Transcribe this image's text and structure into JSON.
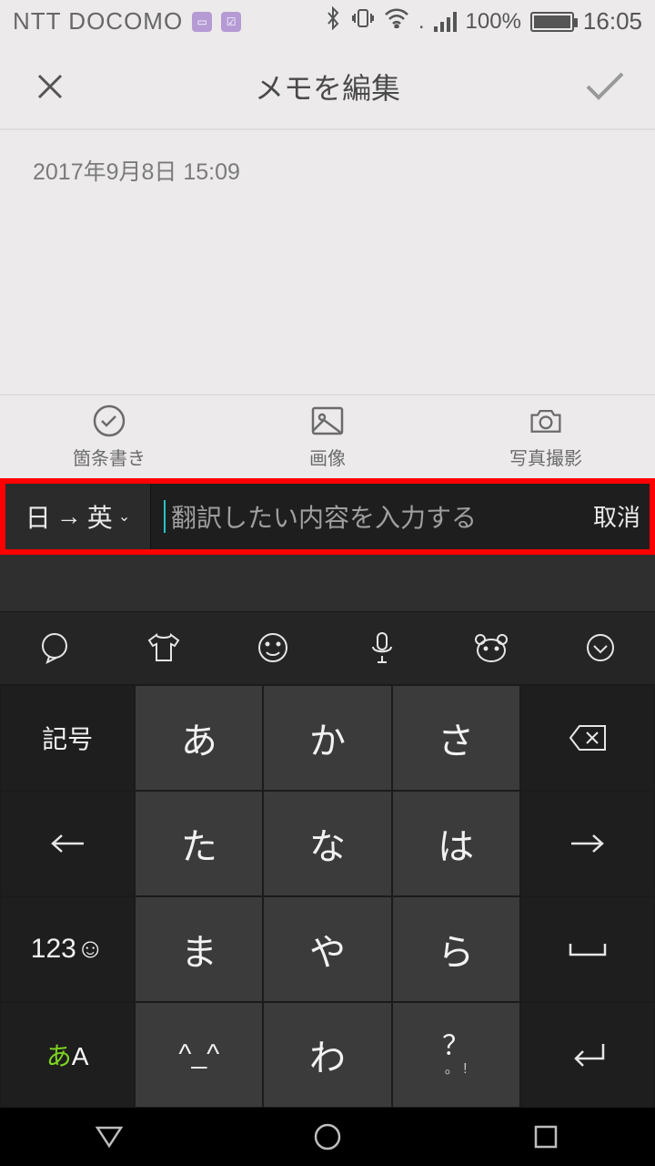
{
  "status": {
    "carrier": "NTT DOCOMO",
    "battery_pct": "100%",
    "clock": "16:05"
  },
  "header": {
    "title": "メモを編集"
  },
  "memo": {
    "timestamp": "2017年9月8日 15:09"
  },
  "toolbar": {
    "bullet": "箇条書き",
    "image": "画像",
    "camera": "写真撮影"
  },
  "translate": {
    "lang_from": "日",
    "lang_to": "英",
    "placeholder": "翻訳したい内容を入力する",
    "cancel": "取消"
  },
  "keys": {
    "sym": "記号",
    "a": "あ",
    "ka": "か",
    "sa": "さ",
    "ta": "た",
    "na": "な",
    "ha": "は",
    "num": "123☺",
    "ma": "ま",
    "ya": "や",
    "ra": "ら",
    "mode_a": "あ",
    "mode_A": "A",
    "face": "^_^",
    "wa": "わ",
    "punct_top": "？",
    "punct_bot": "。 !"
  }
}
